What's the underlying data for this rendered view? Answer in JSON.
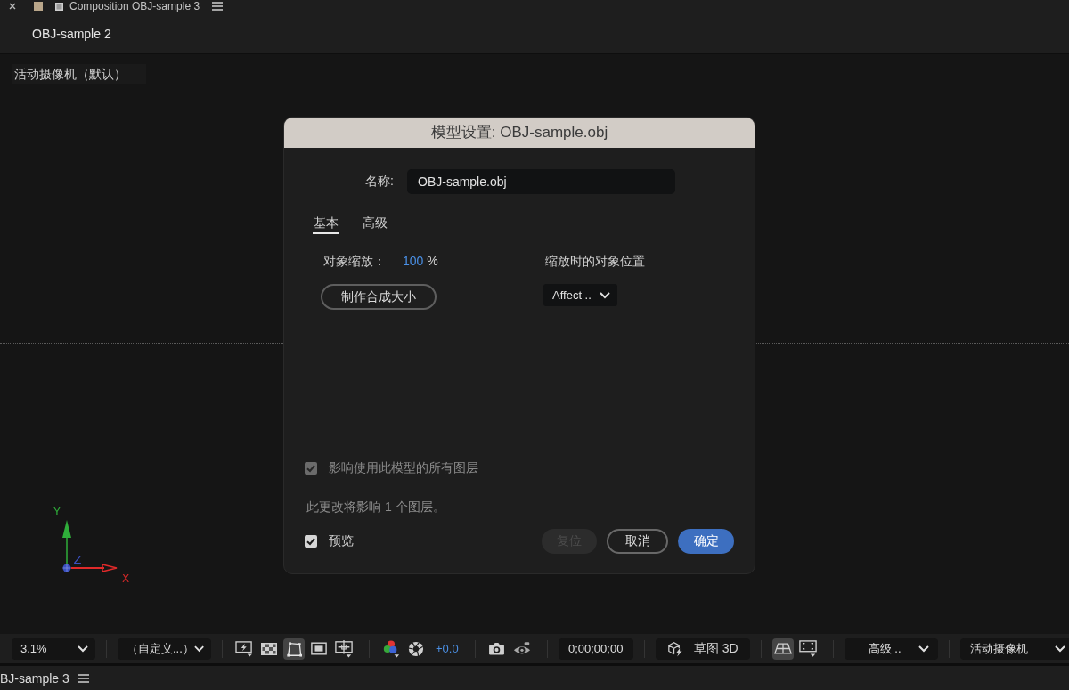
{
  "panel": {
    "title": "Composition OBJ-sample 3"
  },
  "composition_tab": {
    "label": "OBJ-sample 2"
  },
  "viewer": {
    "camera_label": "活动摄像机（默认）",
    "axes": {
      "y_label": "Y",
      "z_label": "Z",
      "x_label": "X"
    }
  },
  "dialog": {
    "title": "模型设置: OBJ-sample.obj",
    "name_label": "名称:",
    "name_value": "OBJ-sample.obj",
    "tabs": [
      {
        "label": "基本",
        "selected": true
      },
      {
        "label": "高级",
        "selected": false
      }
    ],
    "scale_label": "对象缩放：",
    "scale_value": "100",
    "scale_unit": "%",
    "position_label": "缩放时的对象位置",
    "make_comp_size_button": "制作合成大小",
    "position_dropdown": "Affect ..",
    "affect_all": {
      "label": "影响使用此模型的所有图层",
      "checked": true,
      "disabled": true
    },
    "note": "此更改将影响 1 个图层。",
    "preview": {
      "label": "预览",
      "checked": true
    },
    "buttons": [
      {
        "label": "复位",
        "kind": "plain",
        "disabled": true
      },
      {
        "label": "取消",
        "kind": "outline",
        "disabled": false
      },
      {
        "label": "确定",
        "kind": "primary",
        "disabled": false
      }
    ]
  },
  "toolbar": {
    "groups": [
      {
        "items": [
          {
            "kind": "dropdown",
            "label": "3.1%"
          }
        ]
      },
      {
        "items": [
          {
            "kind": "dropdown",
            "label": "（自定义...）"
          }
        ]
      },
      {
        "items": [
          {
            "kind": "icon",
            "selected": false
          },
          {
            "kind": "icon",
            "selected": false
          },
          {
            "kind": "icon",
            "selected": true
          },
          {
            "kind": "icon",
            "selected": false
          },
          {
            "kind": "icon",
            "selected": false
          }
        ]
      },
      {
        "items": [
          {
            "kind": "icon",
            "selected": false
          },
          {
            "kind": "icon",
            "selected": false
          },
          {
            "kind": "value",
            "label": "+0.0"
          }
        ]
      },
      {
        "items": [
          {
            "kind": "icon",
            "selected": false
          },
          {
            "kind": "icon",
            "selected": false
          }
        ]
      },
      {
        "items": [
          {
            "kind": "field",
            "value": "0;00;00;00"
          }
        ]
      },
      {
        "items": [
          {
            "kind": "button",
            "label": "草图 3D"
          }
        ]
      },
      {
        "items": [
          {
            "kind": "icon",
            "selected": true
          },
          {
            "kind": "icon",
            "selected": false
          }
        ]
      },
      {
        "items": [
          {
            "kind": "dropdown",
            "label": "高级 .."
          }
        ]
      },
      {
        "items": [
          {
            "kind": "dropdown",
            "label": "活动摄像机"
          }
        ]
      }
    ]
  },
  "bottom_tab": {
    "label": "BJ-sample 3"
  }
}
